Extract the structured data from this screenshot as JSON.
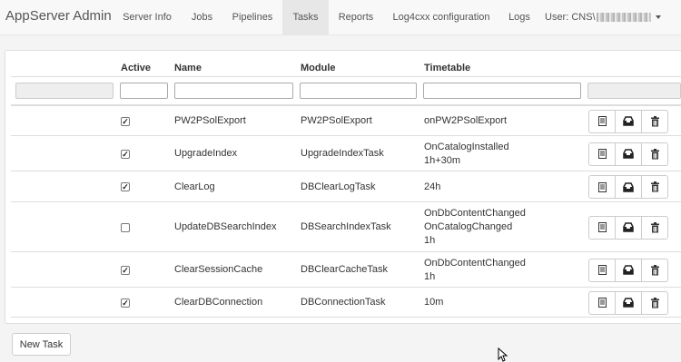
{
  "navbar": {
    "brand": "AppServer Admin",
    "items": [
      {
        "label": "Server Info",
        "active": false
      },
      {
        "label": "Jobs",
        "active": false
      },
      {
        "label": "Pipelines",
        "active": false
      },
      {
        "label": "Tasks",
        "active": true
      },
      {
        "label": "Reports",
        "active": false
      },
      {
        "label": "Log4cxx configuration",
        "active": false
      },
      {
        "label": "Logs",
        "active": false
      }
    ],
    "user_label": "User: CNS\\"
  },
  "table": {
    "headers": {
      "active": "Active",
      "name": "Name",
      "module": "Module",
      "timetable": "Timetable"
    },
    "filters": {
      "name": "",
      "module": "",
      "timetable": ""
    },
    "rows": [
      {
        "active": true,
        "name": "PW2PSolExport",
        "module": "PW2PSolExport",
        "timetable": [
          "onPW2PSolExport"
        ]
      },
      {
        "active": true,
        "name": "UpgradeIndex",
        "module": "UpgradeIndexTask",
        "timetable": [
          "OnCatalogInstalled",
          "1h+30m"
        ]
      },
      {
        "active": true,
        "name": "ClearLog",
        "module": "DBClearLogTask",
        "timetable": [
          "24h"
        ]
      },
      {
        "active": false,
        "name": "UpdateDBSearchIndex",
        "module": "DBSearchIndexTask",
        "timetable": [
          "OnDbContentChanged",
          "OnCatalogChanged",
          "1h"
        ]
      },
      {
        "active": true,
        "name": "ClearSessionCache",
        "module": "DBClearCacheTask",
        "timetable": [
          "OnDbContentChanged",
          "1h"
        ]
      },
      {
        "active": true,
        "name": "ClearDBConnection",
        "module": "DBConnectionTask",
        "timetable": [
          "10m"
        ]
      }
    ],
    "row_actions": [
      "details-icon",
      "inbox-icon",
      "trash-icon"
    ]
  },
  "new_task_label": "New Task"
}
